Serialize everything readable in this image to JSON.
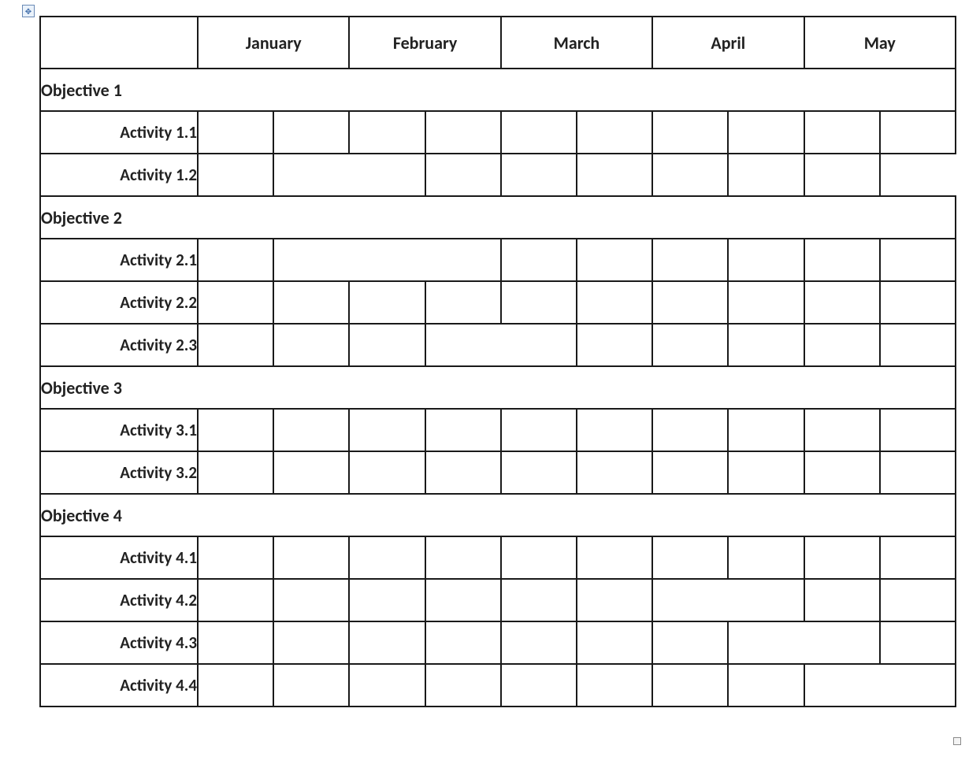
{
  "months": [
    "January",
    "February",
    "March",
    "April",
    "May"
  ],
  "bar_color": "#9ec3e6",
  "groups": [
    {
      "title": "Objective 1",
      "activities": [
        {
          "label": "Activity 1.1",
          "start_half": 0,
          "end_half": 0
        },
        {
          "label": "Activity 1.2",
          "start_half": 1,
          "end_half": 2,
          "row_no_right_border": true
        }
      ]
    },
    {
      "title": "Objective 2",
      "activities": [
        {
          "label": "Activity 2.1",
          "start_half": 1,
          "end_half": 3
        },
        {
          "label": "Activity 2.2",
          "start_half": 3,
          "end_half": 3
        },
        {
          "label": "Activity 2.3",
          "start_half": 3,
          "end_half": 4
        }
      ]
    },
    {
      "title": "Objective 3",
      "activities": [
        {
          "label": "Activity 3.1",
          "start_half": 4,
          "end_half": 4
        },
        {
          "label": "Activity 3.2",
          "start_half": 5,
          "end_half": 5
        }
      ]
    },
    {
      "title": "Objective 4",
      "activities": [
        {
          "label": "Activity 4.1",
          "start_half": 5,
          "end_half": 5
        },
        {
          "label": "Activity 4.2",
          "start_half": 6,
          "end_half": 7
        },
        {
          "label": "Activity 4.3",
          "start_half": 7,
          "end_half": 8
        },
        {
          "label": "Activity 4.4",
          "start_half": 8,
          "end_half": 9
        }
      ]
    }
  ],
  "chart_data": {
    "type": "bar",
    "title": "",
    "xlabel": "",
    "ylabel": "",
    "x_categories_half_months": [
      "January-H1",
      "January-H2",
      "February-H1",
      "February-H2",
      "March-H1",
      "March-H2",
      "April-H1",
      "April-H2",
      "May-H1",
      "May-H2"
    ],
    "series": [
      {
        "name": "Objective 1",
        "type": "section"
      },
      {
        "name": "Activity 1.1",
        "start": "January-H1",
        "end": "January-H1"
      },
      {
        "name": "Activity 1.2",
        "start": "January-H2",
        "end": "February-H1"
      },
      {
        "name": "Objective 2",
        "type": "section"
      },
      {
        "name": "Activity 2.1",
        "start": "January-H2",
        "end": "February-H2"
      },
      {
        "name": "Activity 2.2",
        "start": "February-H2",
        "end": "February-H2"
      },
      {
        "name": "Activity 2.3",
        "start": "February-H2",
        "end": "March-H1"
      },
      {
        "name": "Objective 3",
        "type": "section"
      },
      {
        "name": "Activity 3.1",
        "start": "March-H1",
        "end": "March-H1"
      },
      {
        "name": "Activity 3.2",
        "start": "March-H2",
        "end": "March-H2"
      },
      {
        "name": "Objective 4",
        "type": "section"
      },
      {
        "name": "Activity 4.1",
        "start": "March-H2",
        "end": "March-H2"
      },
      {
        "name": "Activity 4.2",
        "start": "April-H1",
        "end": "April-H2"
      },
      {
        "name": "Activity 4.3",
        "start": "April-H2",
        "end": "May-H1"
      },
      {
        "name": "Activity 4.4",
        "start": "May-H1",
        "end": "May-H2"
      }
    ]
  }
}
